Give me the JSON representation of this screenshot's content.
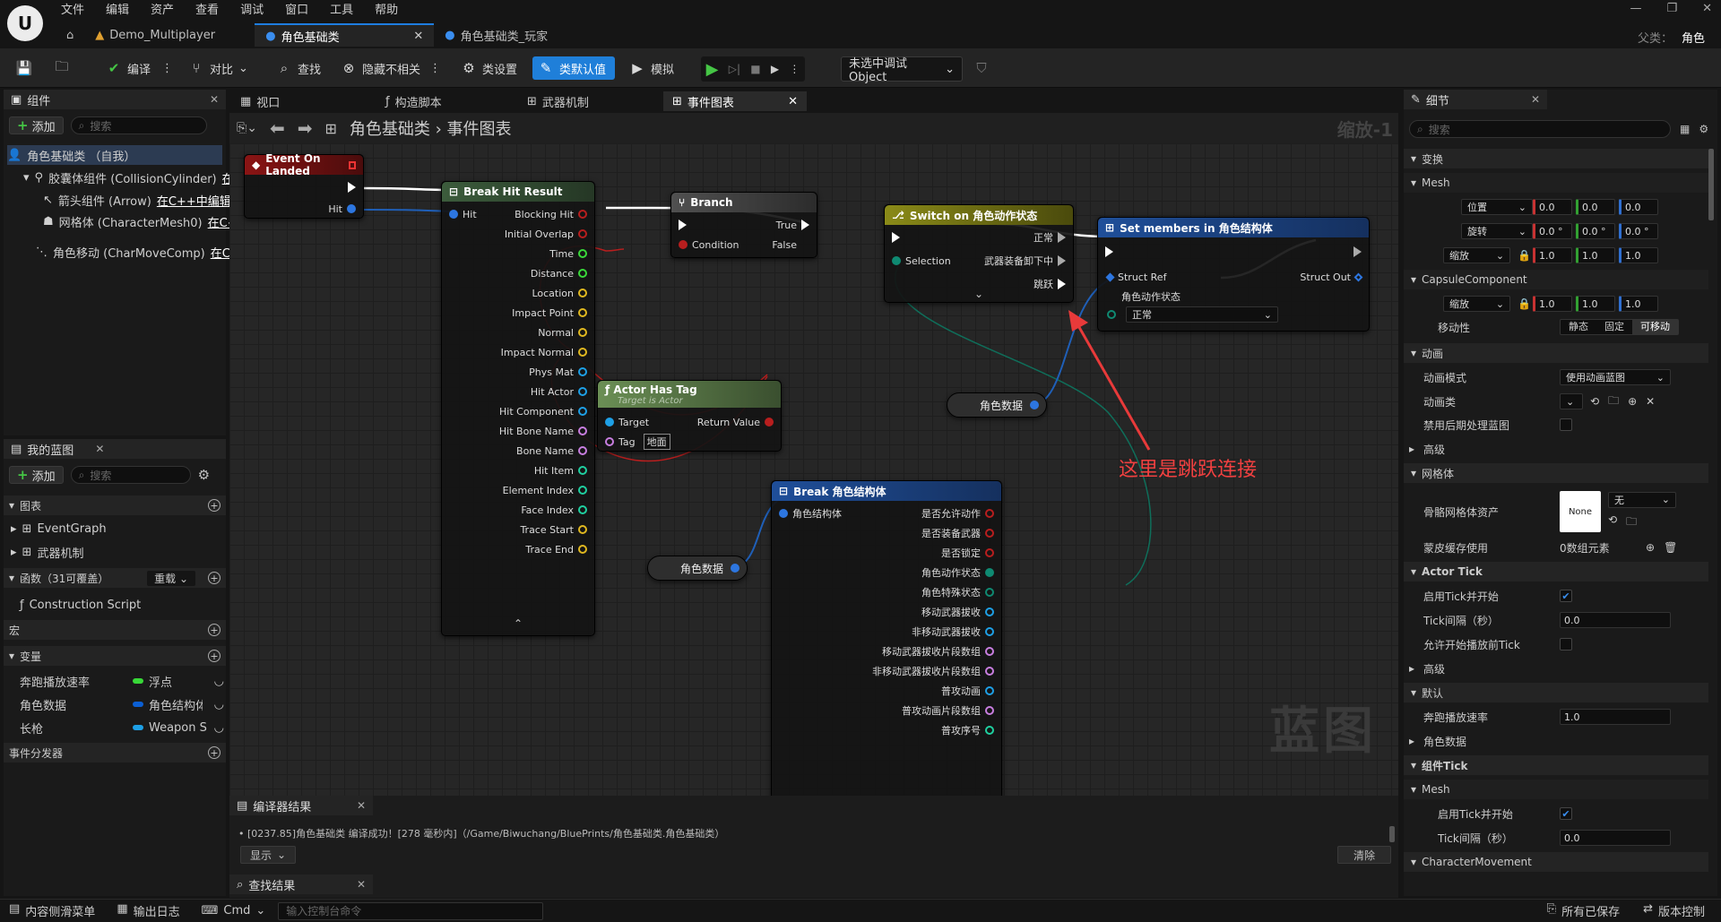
{
  "menu": [
    "文件",
    "编辑",
    "资产",
    "查看",
    "调试",
    "窗口",
    "工具",
    "帮助"
  ],
  "tabs": [
    {
      "label": "Demo_Multiplayer"
    },
    {
      "label": "角色基础类"
    },
    {
      "label": "角色基础类_玩家"
    }
  ],
  "parent_label": "父类：",
  "parent_value": "角色",
  "toolbar": {
    "compile": "编译",
    "diff": "对比",
    "find": "查找",
    "hide_unrelated": "隐藏不相关",
    "class_settings": "类设置",
    "class_defaults": "类默认值",
    "simulate": "模拟",
    "debug_select": "未选中调试Object"
  },
  "components": {
    "title": "组件",
    "add": "添加",
    "search_placeholder": "搜索",
    "items": [
      {
        "label": "角色基础类 （自我）"
      },
      {
        "label": "胶囊体组件 (CollisionCylinder)",
        "suffix": "在"
      },
      {
        "label": "箭头组件 (Arrow)",
        "suffix": "在C++中编辑"
      },
      {
        "label": "网格体 (CharacterMesh0)",
        "suffix": "在C+"
      },
      {
        "label": "角色移动 (CharMoveComp)",
        "suffix": "在C+"
      }
    ]
  },
  "my_blueprint": {
    "title": "我的蓝图",
    "add": "添加",
    "search_placeholder": "搜索",
    "graphs_label": "图表",
    "graphs": [
      "EventGraph",
      "武器机制"
    ],
    "functions_label": "函数（31可覆盖）",
    "override_label": "重载",
    "functions": [
      "Construction Script"
    ],
    "macros_label": "宏",
    "variables_label": "变量",
    "variables": [
      {
        "name": "奔跑播放速率",
        "type": "浮点",
        "color": "#38d838"
      },
      {
        "name": "角色数据",
        "type": "角色结构体",
        "color": "#0b5fd4"
      },
      {
        "name": "长枪",
        "type": "Weapon S",
        "color": "#1ea0e6"
      }
    ],
    "dispatchers_label": "事件分发器"
  },
  "graph_tabs": [
    "视口",
    "构造脚本",
    "武器机制",
    "事件图表"
  ],
  "breadcrumb": {
    "root": "角色基础类",
    "leaf": "事件图表"
  },
  "zoom_label": "缩放-1",
  "watermark": "蓝图",
  "nodes": {
    "event_landed": {
      "title": "Event On Landed",
      "pin_hit": "Hit"
    },
    "break_hit": {
      "title": "Break Hit Result",
      "in_hit": "Hit",
      "outs": [
        "Blocking Hit",
        "Initial Overlap",
        "Time",
        "Distance",
        "Location",
        "Impact Point",
        "Normal",
        "Impact Normal",
        "Phys Mat",
        "Hit Actor",
        "Hit Component",
        "Hit Bone Name",
        "Bone Name",
        "Hit Item",
        "Element Index",
        "Face Index",
        "Trace Start",
        "Trace End"
      ]
    },
    "branch": {
      "title": "Branch",
      "true": "True",
      "false": "False",
      "condition": "Condition"
    },
    "has_tag": {
      "title": "Actor Has Tag",
      "subtitle": "Target is Actor",
      "target": "Target",
      "tag": "Tag",
      "tag_value": "地面",
      "ret": "Return Value"
    },
    "switch": {
      "title": "Switch on 角色动作状态",
      "selection": "Selection",
      "outs": [
        "正常",
        "武器装备卸下中",
        "跳跃"
      ]
    },
    "set_members": {
      "title": "Set members in 角色结构体",
      "struct_ref": "Struct Ref",
      "struct_out": "Struct Out",
      "field": "角色动作状态",
      "field_value": "正常"
    },
    "break_struct": {
      "title": "Break 角色结构体",
      "in": "角色结构体",
      "outs": [
        "是否允许动作",
        "是否装备武器",
        "是否锁定",
        "角色动作状态",
        "角色特殊状态",
        "移动武器拔收",
        "非移动武器拔收",
        "移动武器拔收片段数组",
        "非移动武器拔收片段数组",
        "普攻动画",
        "普攻动画片段数组",
        "普攻序号"
      ]
    },
    "var1": "角色数据",
    "var2": "角色数据"
  },
  "annotation": "这里是跳跃连接",
  "compiler": {
    "title": "编译器结果",
    "log": "[0237.85]角色基础类 编译成功！[278 毫秒内]（/Game/Biwuchang/BluePrints/角色基础类.角色基础类）",
    "show": "显示",
    "clear": "清除"
  },
  "find_results": {
    "title": "查找结果"
  },
  "details": {
    "title": "细节",
    "search_placeholder": "搜索",
    "sections": {
      "transform": "变换",
      "mesh": "Mesh",
      "capsule": "CapsuleComponent",
      "animation": "动画",
      "advanced": "高级",
      "mesh2": "网格体",
      "actor_tick": "Actor Tick",
      "advanced2": "高级",
      "default": "默认",
      "char_data": "角色数据",
      "comp_tick": "组件Tick",
      "mesh3": "Mesh",
      "char_move": "CharacterMovement"
    },
    "position": "位置",
    "rotation": "旋转",
    "scale": "缩放",
    "pos_vals": [
      "0.0",
      "0.0",
      "0.0"
    ],
    "rot_vals": [
      "0.0 °",
      "0.0 °",
      "0.0 °"
    ],
    "scale_vals": [
      "1.0",
      "1.0",
      "1.0"
    ],
    "cap_scale": "缩放",
    "cap_scale_vals": [
      "1.0",
      "1.0",
      "1.0"
    ],
    "mobility": "移动性",
    "mobility_opts": [
      "静态",
      "固定",
      "可移动"
    ],
    "anim_mode": "动画模式",
    "anim_mode_val": "使用动画蓝图",
    "anim_class": "动画类",
    "disable_post": "禁用后期处理蓝图",
    "skeletal_asset": "骨骼网格体资产",
    "none": "None",
    "none2": "无",
    "skin_cache": "蒙皮缓存使用",
    "skin_cache_val": "0数组元素",
    "start_tick": "启用Tick并开始",
    "tick_interval": "Tick间隔（秒）",
    "tick_interval_val": "0.0",
    "allow_tick": "允许开始播放前Tick",
    "run_rate": "奔跑播放速率",
    "run_rate_val": "1.0",
    "start_tick2": "启用Tick并开始",
    "tick_interval2": "Tick间隔（秒）",
    "tick_interval2_val": "0.0"
  },
  "statusbar": {
    "content_drawer": "内容侧滑菜单",
    "output_log": "输出日志",
    "cmd": "Cmd",
    "console_placeholder": "输入控制台命令",
    "saved": "所有已保存",
    "source_control": "版本控制"
  }
}
